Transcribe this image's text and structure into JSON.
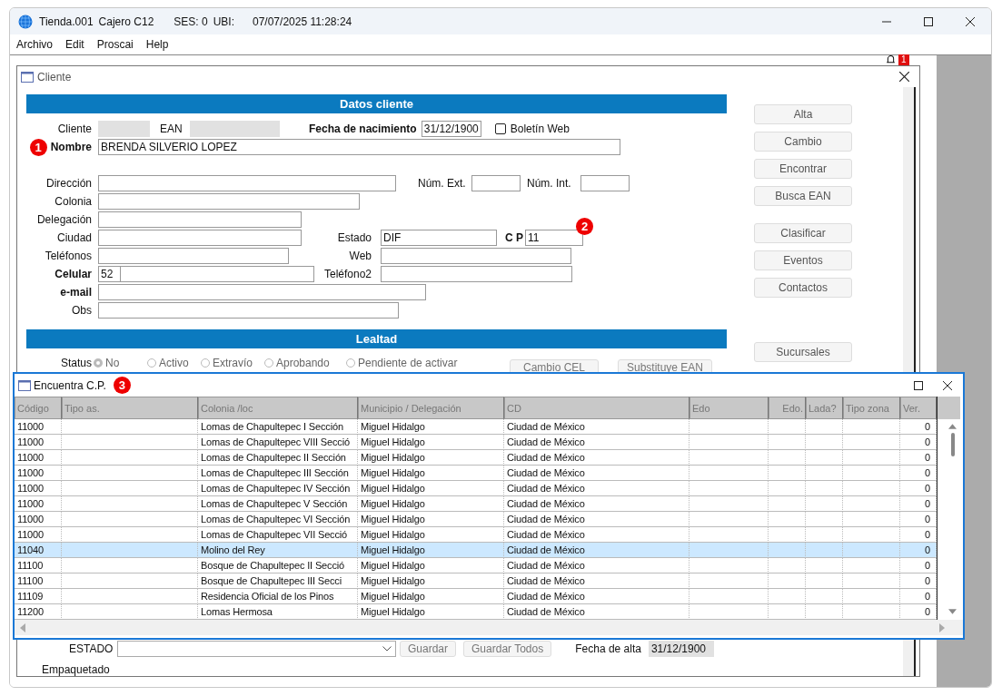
{
  "app": {
    "title": "Tienda.001",
    "cashier": "Cajero C12",
    "session": "SES: 0",
    "location": "UBI:",
    "datetime": "07/07/2025 11:28:24"
  },
  "menu": [
    "Archivo",
    "Edit",
    "Proscai",
    "Help"
  ],
  "notifications": {
    "count": "1"
  },
  "cliente": {
    "title": "Cliente",
    "section_title": "Datos cliente",
    "fields": {
      "cliente": {
        "label": "Cliente"
      },
      "ean": {
        "label": "EAN"
      },
      "fecha_nacimiento": {
        "label": "Fecha de nacimiento",
        "value": "31/12/1900"
      },
      "boletin_web": {
        "label": "Boletín Web",
        "checked": false
      },
      "nombre": {
        "label": "Nombre",
        "value": "BRENDA SILVERIO LOPEZ",
        "marker": "1"
      },
      "direccion": {
        "label": "Dirección"
      },
      "num_ext": {
        "label": "Núm. Ext."
      },
      "num_int": {
        "label": "Núm. Int."
      },
      "colonia": {
        "label": "Colonia"
      },
      "delegacion": {
        "label": "Delegación"
      },
      "ciudad": {
        "label": "Ciudad"
      },
      "estado": {
        "label": "Estado",
        "value": "DIF"
      },
      "cp": {
        "label": "C P",
        "value": "11",
        "marker": "2"
      },
      "telefonos": {
        "label": "Teléfonos"
      },
      "web": {
        "label": "Web"
      },
      "celular": {
        "label": "Celular",
        "prefix": "52"
      },
      "telefono2": {
        "label": "Teléfono2"
      },
      "email": {
        "label": "e-mail"
      },
      "obs": {
        "label": "Obs"
      }
    },
    "loyalty": {
      "title": "Lealtad",
      "status_label": "Status",
      "options": [
        {
          "label": "No",
          "selected": true
        },
        {
          "label": "Activo",
          "selected": false
        },
        {
          "label": "Extravío",
          "selected": false
        },
        {
          "label": "Aprobando",
          "selected": false
        },
        {
          "label": "Pendiente de activar",
          "selected": false
        }
      ],
      "buttons": [
        "Cambio CEL",
        "Substituye EAN"
      ]
    },
    "bottom": {
      "estado_label": "ESTADO",
      "buttons": [
        "Guardar",
        "Guardar Todos"
      ],
      "fecha_alta": {
        "label": "Fecha de alta",
        "value": "31/12/1900"
      },
      "empaquetado": "Empaquetado"
    },
    "side_buttons": [
      [
        "Alta",
        "Cambio",
        "Encontrar",
        "Busca EAN"
      ],
      [
        "Clasificar",
        "Eventos",
        "Contactos"
      ],
      [
        "Sucursales"
      ]
    ]
  },
  "popup": {
    "title": "Encuentra C.P.",
    "marker": "3",
    "columns": [
      "Código",
      "Tipo as.",
      "Colonia /loc",
      "Municipio / Delegación",
      "CD",
      "Edo",
      "Edo.",
      "Lada?",
      "Tipo zona",
      "Ver."
    ],
    "rows": [
      {
        "codigo": "11000",
        "colonia": "Lomas de Chapultepec I Sección",
        "municipio": "Miguel Hidalgo",
        "cd": "Ciudad de México",
        "ver": "0",
        "selected": false
      },
      {
        "codigo": "11000",
        "colonia": "Lomas de Chapultepec VIII Secció",
        "municipio": "Miguel Hidalgo",
        "cd": "Ciudad de México",
        "ver": "0",
        "selected": false
      },
      {
        "codigo": "11000",
        "colonia": "Lomas de Chapultepec II Sección",
        "municipio": "Miguel Hidalgo",
        "cd": "Ciudad de México",
        "ver": "0",
        "selected": false
      },
      {
        "codigo": "11000",
        "colonia": "Lomas de Chapultepec III Sección",
        "municipio": "Miguel Hidalgo",
        "cd": "Ciudad de México",
        "ver": "0",
        "selected": false
      },
      {
        "codigo": "11000",
        "colonia": "Lomas de Chapultepec IV Sección",
        "municipio": "Miguel Hidalgo",
        "cd": "Ciudad de México",
        "ver": "0",
        "selected": false
      },
      {
        "codigo": "11000",
        "colonia": "Lomas de Chapultepec V Sección",
        "municipio": "Miguel Hidalgo",
        "cd": "Ciudad de México",
        "ver": "0",
        "selected": false
      },
      {
        "codigo": "11000",
        "colonia": "Lomas de Chapultepec VI Sección",
        "municipio": "Miguel Hidalgo",
        "cd": "Ciudad de México",
        "ver": "0",
        "selected": false
      },
      {
        "codigo": "11000",
        "colonia": "Lomas de Chapultepec VII Secció",
        "municipio": "Miguel Hidalgo",
        "cd": "Ciudad de México",
        "ver": "0",
        "selected": false
      },
      {
        "codigo": "11040",
        "colonia": "Molino del Rey",
        "municipio": "Miguel Hidalgo",
        "cd": "Ciudad de México",
        "ver": "0",
        "selected": true
      },
      {
        "codigo": "11100",
        "colonia": "Bosque de Chapultepec II Secció",
        "municipio": "Miguel Hidalgo",
        "cd": "Ciudad de México",
        "ver": "0",
        "selected": false
      },
      {
        "codigo": "11100",
        "colonia": "Bosque de Chapultepec III Secci",
        "municipio": "Miguel Hidalgo",
        "cd": "Ciudad de México",
        "ver": "0",
        "selected": false
      },
      {
        "codigo": "11109",
        "colonia": "Residencia Oficial de los Pinos",
        "municipio": "Miguel Hidalgo",
        "cd": "Ciudad de México",
        "ver": "0",
        "selected": false
      },
      {
        "codigo": "11200",
        "colonia": "Lomas Hermosa",
        "municipio": "Miguel Hidalgo",
        "cd": "Ciudad de México",
        "ver": "0",
        "selected": false
      }
    ]
  }
}
